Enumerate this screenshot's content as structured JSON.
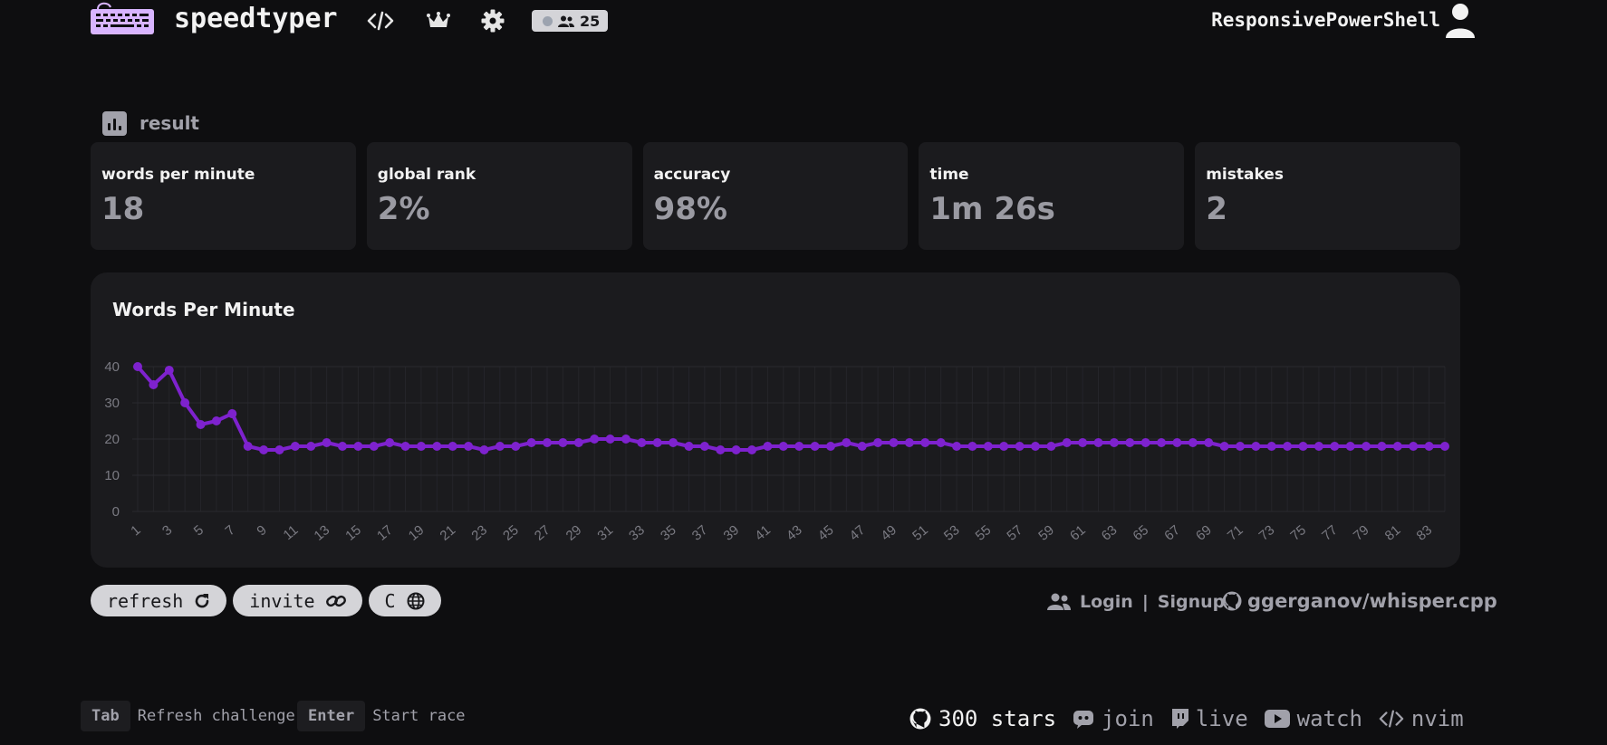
{
  "header": {
    "brand": "speedtyper",
    "online_count": "25",
    "username": "ResponsivePowerShell",
    "icons": [
      "keyboard-logo-icon",
      "code-icon",
      "crown-icon",
      "gear-icon",
      "users-icon",
      "user-icon"
    ]
  },
  "result": {
    "heading": "result",
    "stats": [
      {
        "label": "words per minute",
        "value": "18"
      },
      {
        "label": "global rank",
        "value": "2%"
      },
      {
        "label": "accuracy",
        "value": "98%"
      },
      {
        "label": "time",
        "value": "1m 26s"
      },
      {
        "label": "mistakes",
        "value": "2"
      }
    ]
  },
  "chart_title": "Words Per Minute",
  "chart_data": {
    "type": "line",
    "title": "Words Per Minute",
    "xlabel": "",
    "ylabel": "",
    "ylim": [
      0,
      40
    ],
    "yticks": [
      0,
      10,
      20,
      30,
      40
    ],
    "x": [
      1,
      2,
      3,
      4,
      5,
      6,
      7,
      8,
      9,
      10,
      11,
      12,
      13,
      14,
      15,
      16,
      17,
      18,
      19,
      20,
      21,
      22,
      23,
      24,
      25,
      26,
      27,
      28,
      29,
      30,
      31,
      32,
      33,
      34,
      35,
      36,
      37,
      38,
      39,
      40,
      41,
      42,
      43,
      44,
      45,
      46,
      47,
      48,
      49,
      50,
      51,
      52,
      53,
      54,
      55,
      56,
      57,
      58,
      59,
      60,
      61,
      62,
      63,
      64,
      65,
      66,
      67,
      68,
      69,
      70,
      71,
      72,
      73,
      74,
      75,
      76,
      77,
      78,
      79,
      80,
      81,
      82,
      83,
      84
    ],
    "xticks": [
      1,
      3,
      5,
      7,
      9,
      11,
      13,
      15,
      17,
      19,
      21,
      23,
      25,
      27,
      29,
      31,
      33,
      35,
      37,
      39,
      41,
      43,
      45,
      47,
      49,
      51,
      53,
      55,
      57,
      59,
      61,
      63,
      65,
      67,
      69,
      71,
      73,
      75,
      77,
      79,
      81,
      83
    ],
    "series": [
      {
        "values": [
          40,
          35,
          39,
          30,
          24,
          25,
          27,
          18,
          17,
          17,
          18,
          18,
          19,
          18,
          18,
          18,
          19,
          18,
          18,
          18,
          18,
          18,
          17,
          18,
          18,
          19,
          19,
          19,
          19,
          20,
          20,
          20,
          19,
          19,
          19,
          18,
          18,
          17,
          17,
          17,
          18,
          18,
          18,
          18,
          18,
          19,
          18,
          19,
          19,
          19,
          19,
          19,
          18,
          18,
          18,
          18,
          18,
          18,
          18,
          19,
          19,
          19,
          19,
          19,
          19,
          19,
          19,
          19,
          19,
          18,
          18,
          18,
          18,
          18,
          18,
          18,
          18,
          18,
          18,
          18,
          18,
          18,
          18,
          18
        ]
      }
    ],
    "color": "#7e22ce",
    "grid": true
  },
  "actions": {
    "refresh": "refresh",
    "invite": "invite",
    "language": "C"
  },
  "auth": {
    "login": "Login",
    "separator": "|",
    "signup": "Signup"
  },
  "repo": "ggerganov/whisper.cpp",
  "shortcuts": [
    {
      "key": "Tab",
      "desc": "Refresh challenge"
    },
    {
      "key": "Enter",
      "desc": "Start race"
    }
  ],
  "footer": {
    "stars": "300 stars",
    "join": "join",
    "live": "live",
    "watch": "watch",
    "nvim": "nvim"
  }
}
